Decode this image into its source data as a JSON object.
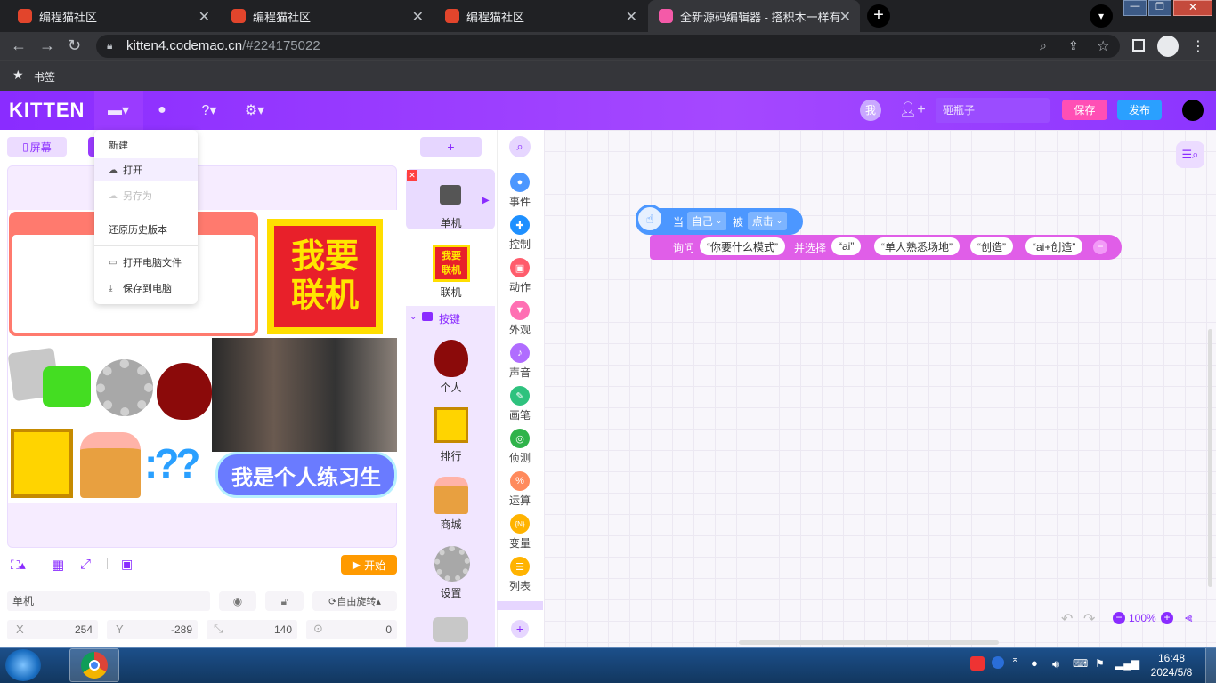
{
  "browser": {
    "tabs": [
      {
        "title": "编程猫社区",
        "active": false
      },
      {
        "title": "编程猫社区",
        "active": false
      },
      {
        "title": "编程猫社区",
        "active": false
      },
      {
        "title": "全新源码编辑器 - 搭积木一样有趣",
        "active": true
      }
    ],
    "url_host": "kitten4.codemao.cn",
    "url_path": "/#224175022",
    "bookmarks_label": "书签"
  },
  "app": {
    "logo": "KITTEN",
    "user_badge": "我",
    "project_name": "砸瓶子",
    "save_label": "保存",
    "publish_label": "发布"
  },
  "file_menu": {
    "items": [
      {
        "label": "新建",
        "enabled": true
      },
      {
        "label": "打开",
        "enabled": true
      },
      {
        "label": "另存为",
        "enabled": false
      },
      {
        "label": "还原历史版本",
        "enabled": true
      },
      {
        "label": "打开电脑文件",
        "enabled": true
      },
      {
        "label": "保存到电脑",
        "enabled": true
      }
    ]
  },
  "stage": {
    "screen_tab": "屏幕",
    "banner_text_1": "我要",
    "banner_text_2": "联机",
    "trainee_text": "我是个人练习生",
    "start_label": "开始"
  },
  "sprite_props": {
    "name": "单机",
    "rotation_mode": "自由旋转",
    "x_label": "X",
    "x_value": "254",
    "y_label": "Y",
    "y_value": "-289",
    "size_value": "140",
    "direction_value": "0"
  },
  "sprites": {
    "add_label": "+",
    "items": [
      "单机",
      "联机"
    ],
    "group_label": "按键",
    "group_items": [
      "个人",
      "排行",
      "商城",
      "设置"
    ]
  },
  "categories": [
    {
      "label": "事件",
      "color": "#4c97ff"
    },
    {
      "label": "控制",
      "color": "#1e90ff"
    },
    {
      "label": "动作",
      "color": "#ff5c6c"
    },
    {
      "label": "外观",
      "color": "#ff6fb3"
    },
    {
      "label": "声音",
      "color": "#b06cff"
    },
    {
      "label": "画笔",
      "color": "#2ec27e"
    },
    {
      "label": "侦测",
      "color": "#2fb34a"
    },
    {
      "label": "运算",
      "color": "#ff8a5c"
    },
    {
      "label": "变量",
      "color": "#ffb300"
    },
    {
      "label": "列表",
      "color": "#ffb300"
    }
  ],
  "blocks": {
    "when_label": "当",
    "self_label": "自己",
    "is_label": "被",
    "clicked_label": "点击",
    "ask_label": "询问",
    "question": "“你要什么模式”",
    "choose_label": "并选择",
    "options": [
      "“ai”",
      "“单人熟悉场地”",
      "“创造”",
      "“ai+创造”"
    ]
  },
  "workspace": {
    "zoom": "100%"
  },
  "taskbar": {
    "time": "16:48",
    "date": "2024/5/8"
  }
}
